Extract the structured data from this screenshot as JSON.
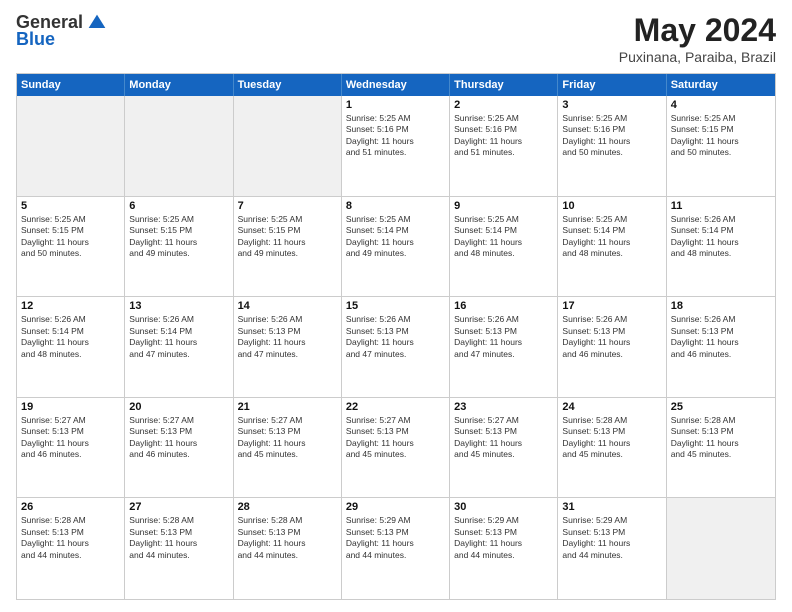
{
  "logo": {
    "general": "General",
    "blue": "Blue"
  },
  "title": "May 2024",
  "subtitle": "Puxinana, Paraiba, Brazil",
  "header_days": [
    "Sunday",
    "Monday",
    "Tuesday",
    "Wednesday",
    "Thursday",
    "Friday",
    "Saturday"
  ],
  "weeks": [
    [
      {
        "day": "",
        "text": "",
        "shaded": true
      },
      {
        "day": "",
        "text": "",
        "shaded": true
      },
      {
        "day": "",
        "text": "",
        "shaded": true
      },
      {
        "day": "1",
        "text": "Sunrise: 5:25 AM\nSunset: 5:16 PM\nDaylight: 11 hours\nand 51 minutes.",
        "shaded": false
      },
      {
        "day": "2",
        "text": "Sunrise: 5:25 AM\nSunset: 5:16 PM\nDaylight: 11 hours\nand 51 minutes.",
        "shaded": false
      },
      {
        "day": "3",
        "text": "Sunrise: 5:25 AM\nSunset: 5:16 PM\nDaylight: 11 hours\nand 50 minutes.",
        "shaded": false
      },
      {
        "day": "4",
        "text": "Sunrise: 5:25 AM\nSunset: 5:15 PM\nDaylight: 11 hours\nand 50 minutes.",
        "shaded": false
      }
    ],
    [
      {
        "day": "5",
        "text": "Sunrise: 5:25 AM\nSunset: 5:15 PM\nDaylight: 11 hours\nand 50 minutes.",
        "shaded": false
      },
      {
        "day": "6",
        "text": "Sunrise: 5:25 AM\nSunset: 5:15 PM\nDaylight: 11 hours\nand 49 minutes.",
        "shaded": false
      },
      {
        "day": "7",
        "text": "Sunrise: 5:25 AM\nSunset: 5:15 PM\nDaylight: 11 hours\nand 49 minutes.",
        "shaded": false
      },
      {
        "day": "8",
        "text": "Sunrise: 5:25 AM\nSunset: 5:14 PM\nDaylight: 11 hours\nand 49 minutes.",
        "shaded": false
      },
      {
        "day": "9",
        "text": "Sunrise: 5:25 AM\nSunset: 5:14 PM\nDaylight: 11 hours\nand 48 minutes.",
        "shaded": false
      },
      {
        "day": "10",
        "text": "Sunrise: 5:25 AM\nSunset: 5:14 PM\nDaylight: 11 hours\nand 48 minutes.",
        "shaded": false
      },
      {
        "day": "11",
        "text": "Sunrise: 5:26 AM\nSunset: 5:14 PM\nDaylight: 11 hours\nand 48 minutes.",
        "shaded": false
      }
    ],
    [
      {
        "day": "12",
        "text": "Sunrise: 5:26 AM\nSunset: 5:14 PM\nDaylight: 11 hours\nand 48 minutes.",
        "shaded": false
      },
      {
        "day": "13",
        "text": "Sunrise: 5:26 AM\nSunset: 5:14 PM\nDaylight: 11 hours\nand 47 minutes.",
        "shaded": false
      },
      {
        "day": "14",
        "text": "Sunrise: 5:26 AM\nSunset: 5:13 PM\nDaylight: 11 hours\nand 47 minutes.",
        "shaded": false
      },
      {
        "day": "15",
        "text": "Sunrise: 5:26 AM\nSunset: 5:13 PM\nDaylight: 11 hours\nand 47 minutes.",
        "shaded": false
      },
      {
        "day": "16",
        "text": "Sunrise: 5:26 AM\nSunset: 5:13 PM\nDaylight: 11 hours\nand 47 minutes.",
        "shaded": false
      },
      {
        "day": "17",
        "text": "Sunrise: 5:26 AM\nSunset: 5:13 PM\nDaylight: 11 hours\nand 46 minutes.",
        "shaded": false
      },
      {
        "day": "18",
        "text": "Sunrise: 5:26 AM\nSunset: 5:13 PM\nDaylight: 11 hours\nand 46 minutes.",
        "shaded": false
      }
    ],
    [
      {
        "day": "19",
        "text": "Sunrise: 5:27 AM\nSunset: 5:13 PM\nDaylight: 11 hours\nand 46 minutes.",
        "shaded": false
      },
      {
        "day": "20",
        "text": "Sunrise: 5:27 AM\nSunset: 5:13 PM\nDaylight: 11 hours\nand 46 minutes.",
        "shaded": false
      },
      {
        "day": "21",
        "text": "Sunrise: 5:27 AM\nSunset: 5:13 PM\nDaylight: 11 hours\nand 45 minutes.",
        "shaded": false
      },
      {
        "day": "22",
        "text": "Sunrise: 5:27 AM\nSunset: 5:13 PM\nDaylight: 11 hours\nand 45 minutes.",
        "shaded": false
      },
      {
        "day": "23",
        "text": "Sunrise: 5:27 AM\nSunset: 5:13 PM\nDaylight: 11 hours\nand 45 minutes.",
        "shaded": false
      },
      {
        "day": "24",
        "text": "Sunrise: 5:28 AM\nSunset: 5:13 PM\nDaylight: 11 hours\nand 45 minutes.",
        "shaded": false
      },
      {
        "day": "25",
        "text": "Sunrise: 5:28 AM\nSunset: 5:13 PM\nDaylight: 11 hours\nand 45 minutes.",
        "shaded": false
      }
    ],
    [
      {
        "day": "26",
        "text": "Sunrise: 5:28 AM\nSunset: 5:13 PM\nDaylight: 11 hours\nand 44 minutes.",
        "shaded": false
      },
      {
        "day": "27",
        "text": "Sunrise: 5:28 AM\nSunset: 5:13 PM\nDaylight: 11 hours\nand 44 minutes.",
        "shaded": false
      },
      {
        "day": "28",
        "text": "Sunrise: 5:28 AM\nSunset: 5:13 PM\nDaylight: 11 hours\nand 44 minutes.",
        "shaded": false
      },
      {
        "day": "29",
        "text": "Sunrise: 5:29 AM\nSunset: 5:13 PM\nDaylight: 11 hours\nand 44 minutes.",
        "shaded": false
      },
      {
        "day": "30",
        "text": "Sunrise: 5:29 AM\nSunset: 5:13 PM\nDaylight: 11 hours\nand 44 minutes.",
        "shaded": false
      },
      {
        "day": "31",
        "text": "Sunrise: 5:29 AM\nSunset: 5:13 PM\nDaylight: 11 hours\nand 44 minutes.",
        "shaded": false
      },
      {
        "day": "",
        "text": "",
        "shaded": true
      }
    ]
  ]
}
